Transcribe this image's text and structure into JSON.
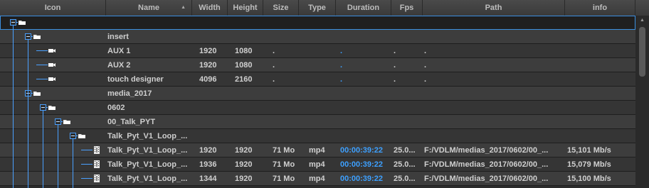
{
  "columns": {
    "icon": "Icon",
    "name": "Name",
    "width": "Width",
    "height": "Height",
    "size": "Size",
    "type": "Type",
    "duration": "Duration",
    "fps": "Fps",
    "path": "Path",
    "info": "info"
  },
  "sort": {
    "column": "name",
    "direction": "ascending"
  },
  "colors": {
    "accent": "#4aa0ff",
    "duration_text": "#3da0ff"
  },
  "rows": [
    {
      "depth": 0,
      "kind": "folder",
      "name": "",
      "width": "",
      "height": "",
      "size": "",
      "type": "",
      "duration": "",
      "fps": "",
      "path": "",
      "info": "",
      "selected": true,
      "expanded": true
    },
    {
      "depth": 1,
      "kind": "folder",
      "name": "insert",
      "width": "",
      "height": "",
      "size": "",
      "type": "",
      "duration": "",
      "fps": "",
      "path": "",
      "info": "",
      "expanded": true
    },
    {
      "depth": 2,
      "kind": "camera",
      "name": "AUX 1",
      "width": "1920",
      "height": "1080",
      "size": ".",
      "type": "",
      "duration": ".",
      "fps": ".",
      "path": ".",
      "info": ""
    },
    {
      "depth": 2,
      "kind": "camera",
      "name": "AUX 2",
      "width": "1920",
      "height": "1080",
      "size": ".",
      "type": "",
      "duration": ".",
      "fps": ".",
      "path": ".",
      "info": ""
    },
    {
      "depth": 2,
      "kind": "camera",
      "name": "touch designer",
      "width": "4096",
      "height": "2160",
      "size": ".",
      "type": "",
      "duration": ".",
      "fps": ".",
      "path": ".",
      "info": ""
    },
    {
      "depth": 1,
      "kind": "folder",
      "name": "media_2017",
      "width": "",
      "height": "",
      "size": "",
      "type": "",
      "duration": "",
      "fps": "",
      "path": "",
      "info": "",
      "expanded": true
    },
    {
      "depth": 2,
      "kind": "folder",
      "name": "0602",
      "width": "",
      "height": "",
      "size": "",
      "type": "",
      "duration": "",
      "fps": "",
      "path": "",
      "info": "",
      "expanded": true
    },
    {
      "depth": 3,
      "kind": "folder",
      "name": "00_Talk_PYT",
      "width": "",
      "height": "",
      "size": "",
      "type": "",
      "duration": "",
      "fps": "",
      "path": "",
      "info": "",
      "expanded": true
    },
    {
      "depth": 4,
      "kind": "folder",
      "name": "Talk_Pyt_V1_Loop_...",
      "width": "",
      "height": "",
      "size": "",
      "type": "",
      "duration": "",
      "fps": "",
      "path": "",
      "info": "",
      "expanded": true
    },
    {
      "depth": 5,
      "kind": "film",
      "name": "Talk_Pyt_V1_Loop_...",
      "width": "1920",
      "height": "1920",
      "size": "71 Mo",
      "type": "mp4",
      "duration": "00:00:39:22",
      "fps": "25.0...",
      "path": "F:/VDLM/medias_2017/0602/00_...",
      "info": "15,101 Mb/s"
    },
    {
      "depth": 5,
      "kind": "film",
      "name": "Talk_Pyt_V1_Loop_...",
      "width": "1936",
      "height": "1920",
      "size": "71 Mo",
      "type": "mp4",
      "duration": "00:00:39:22",
      "fps": "25.0...",
      "path": "F:/VDLM/medias_2017/0602/00_...",
      "info": "15,079 Mb/s"
    },
    {
      "depth": 5,
      "kind": "film",
      "name": "Talk_Pyt_V1_Loop_...",
      "width": "1344",
      "height": "1920",
      "size": "71 Mo",
      "type": "mp4",
      "duration": "00:00:39:22",
      "fps": "25.0...",
      "path": "F:/VDLM/medias_2017/0602/00_...",
      "info": "15,100 Mb/s"
    }
  ]
}
